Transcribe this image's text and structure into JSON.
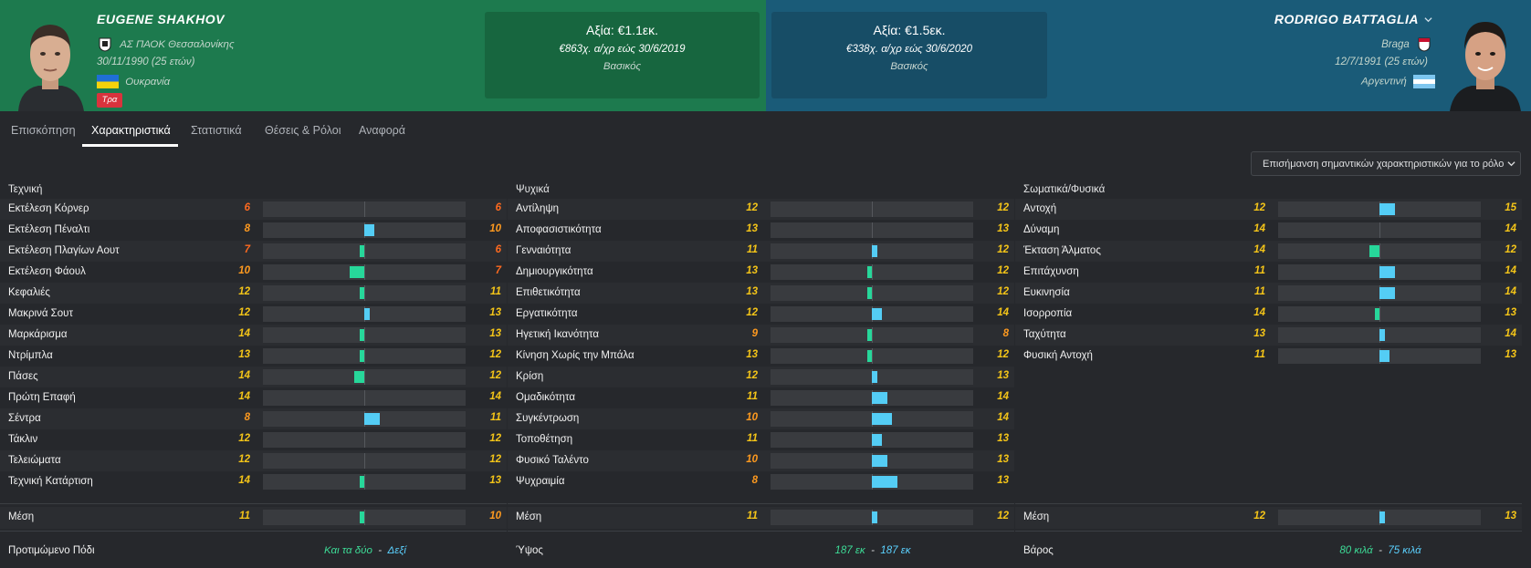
{
  "colors": {
    "high": "#f5c518",
    "mid": "#ff9a1f",
    "low": "#ff6a1f",
    "player1_bar": "#27d79a",
    "player2_bar": "#54cdf5"
  },
  "player1": {
    "name": "EUGENE SHAKHOV",
    "club": "ΑΣ ΠΑΟΚ Θεσσαλονίκης",
    "dob": "30/11/1990 (25 ετών)",
    "nationality": "Ουκρανία",
    "badge": "Τρα",
    "value": "Αξία: €1.1εκ.",
    "contract": "€863χ. α/χρ εώς 30/6/2019",
    "status": "Βασικός"
  },
  "player2": {
    "name": "RODRIGO BATTAGLIA",
    "club": "Braga",
    "dob": "12/7/1991 (25 ετών)",
    "nationality": "Αργεντινή",
    "value": "Αξία: €1.5εκ.",
    "contract": "€338χ. α/χρ εώς 30/6/2020",
    "status": "Βασικός"
  },
  "tabs": [
    "Επισκόπηση",
    "Χαρακτηριστικά",
    "Στατιστικά",
    "Θέσεις & Ρόλοι",
    "Αναφορά"
  ],
  "highlight_select": "Επισήμανση σημαντικών χαρακτηριστικών για το ρόλο",
  "panels": [
    {
      "title": "Τεχνική",
      "attributes": [
        {
          "name": "Εκτέλεση Κόρνερ",
          "p1": 6,
          "p2": 6
        },
        {
          "name": "Εκτέλεση Πέναλτι",
          "p1": 8,
          "p2": 10
        },
        {
          "name": "Εκτέλεση Πλαγίων Αουτ",
          "p1": 7,
          "p2": 6
        },
        {
          "name": "Εκτέλεση Φάουλ",
          "p1": 10,
          "p2": 7
        },
        {
          "name": "Κεφαλιές",
          "p1": 12,
          "p2": 11
        },
        {
          "name": "Μακρινά Σουτ",
          "p1": 12,
          "p2": 13
        },
        {
          "name": "Μαρκάρισμα",
          "p1": 14,
          "p2": 13
        },
        {
          "name": "Ντρίμπλα",
          "p1": 13,
          "p2": 12
        },
        {
          "name": "Πάσες",
          "p1": 14,
          "p2": 12
        },
        {
          "name": "Πρώτη Επαφή",
          "p1": 14,
          "p2": 14
        },
        {
          "name": "Σέντρα",
          "p1": 8,
          "p2": 11
        },
        {
          "name": "Τάκλιν",
          "p1": 12,
          "p2": 12
        },
        {
          "name": "Τελειώματα",
          "p1": 12,
          "p2": 12
        },
        {
          "name": "Τεχνική Κατάρτιση",
          "p1": 14,
          "p2": 13
        }
      ],
      "average": {
        "label": "Μέση",
        "p1": 11,
        "p2": 10
      },
      "footer": {
        "label": "Προτιμώμενο Πόδι",
        "p1": "Και τα δύο",
        "sep": "-",
        "p2": "Δεξί"
      }
    },
    {
      "title": "Ψυχικά",
      "attributes": [
        {
          "name": "Αντίληψη",
          "p1": 12,
          "p2": 12
        },
        {
          "name": "Αποφασιστικότητα",
          "p1": 13,
          "p2": 13
        },
        {
          "name": "Γενναιότητα",
          "p1": 11,
          "p2": 12
        },
        {
          "name": "Δημιουργικότητα",
          "p1": 13,
          "p2": 12
        },
        {
          "name": "Επιθετικότητα",
          "p1": 13,
          "p2": 12
        },
        {
          "name": "Εργατικότητα",
          "p1": 12,
          "p2": 14
        },
        {
          "name": "Ηγετική Ικανότητα",
          "p1": 9,
          "p2": 8
        },
        {
          "name": "Κίνηση Χωρίς την Μπάλα",
          "p1": 13,
          "p2": 12
        },
        {
          "name": "Κρίση",
          "p1": 12,
          "p2": 13
        },
        {
          "name": "Ομαδικότητα",
          "p1": 11,
          "p2": 14
        },
        {
          "name": "Συγκέντρωση",
          "p1": 10,
          "p2": 14
        },
        {
          "name": "Τοποθέτηση",
          "p1": 11,
          "p2": 13
        },
        {
          "name": "Φυσικό Ταλέντο",
          "p1": 10,
          "p2": 13
        },
        {
          "name": "Ψυχραιμία",
          "p1": 8,
          "p2": 13
        }
      ],
      "average": {
        "label": "Μέση",
        "p1": 11,
        "p2": 12
      },
      "footer": {
        "label": "Ύψος",
        "p1": "187 εκ",
        "sep": "-",
        "p2": "187 εκ"
      }
    },
    {
      "title": "Σωματικά/Φυσικά",
      "attributes": [
        {
          "name": "Αντοχή",
          "p1": 12,
          "p2": 15
        },
        {
          "name": "Δύναμη",
          "p1": 14,
          "p2": 14
        },
        {
          "name": "Έκταση Άλματος",
          "p1": 14,
          "p2": 12
        },
        {
          "name": "Επιτάχυνση",
          "p1": 11,
          "p2": 14
        },
        {
          "name": "Ευκινησία",
          "p1": 11,
          "p2": 14
        },
        {
          "name": "Ισορροπία",
          "p1": 14,
          "p2": 13
        },
        {
          "name": "Ταχύτητα",
          "p1": 13,
          "p2": 14
        },
        {
          "name": "Φυσική Αντοχή",
          "p1": 11,
          "p2": 13
        }
      ],
      "average": {
        "label": "Μέση",
        "p1": 12,
        "p2": 13
      },
      "footer": {
        "label": "Βάρος",
        "p1": "80 κιλά",
        "sep": "-",
        "p2": "75 κιλά"
      }
    }
  ]
}
